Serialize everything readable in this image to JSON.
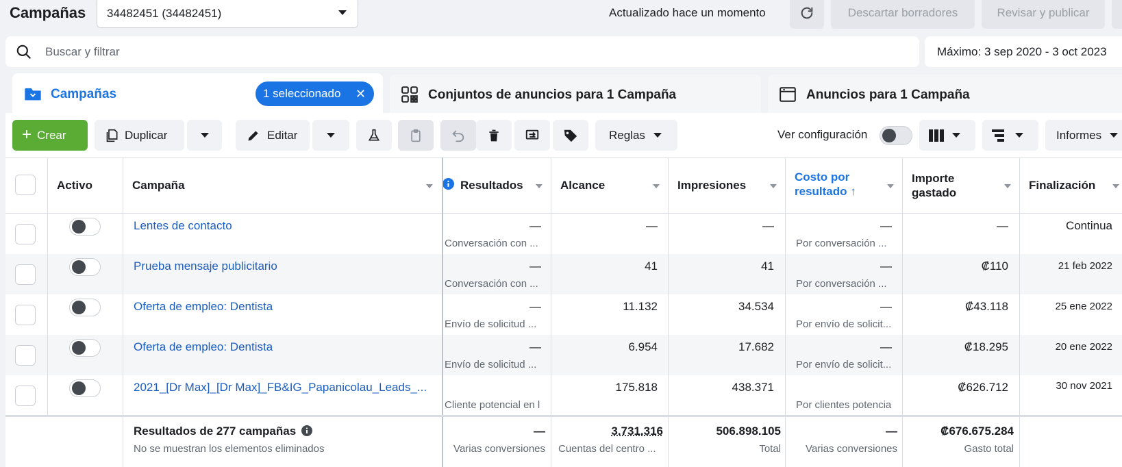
{
  "header": {
    "title": "Campañas",
    "account": "34482451 (34482451)",
    "updated": "Actualizado hace un momento",
    "discard": "Descartar borradores",
    "publish": "Revisar y publicar"
  },
  "search": {
    "placeholder": "Buscar y filtrar",
    "date_range": "Máximo: 3 sep 2020 - 3 oct 2023"
  },
  "tabs": [
    {
      "label": "Campañas",
      "selected_pill": "1 seleccionado",
      "icon": "folder-icon"
    },
    {
      "label": "Conjuntos de anuncios para 1 Campaña",
      "icon": "grid-icon"
    },
    {
      "label": "Anuncios para 1 Campaña",
      "icon": "ad-icon"
    }
  ],
  "toolbar": {
    "create": "Crear",
    "duplicate": "Duplicar",
    "edit": "Editar",
    "rules": "Reglas",
    "view_settings": "Ver configuración",
    "reports": "Informes"
  },
  "columns": {
    "active": "Activo",
    "campaign": "Campaña",
    "results": "Resultados",
    "reach": "Alcance",
    "impressions": "Impresiones",
    "cost_line1": "Costo por",
    "cost_line2": "resultado ↑",
    "spent_line1": "Importe",
    "spent_line2": "gastado",
    "end": "Finalización"
  },
  "rows": [
    {
      "name": "Lentes de contacto",
      "results": "—",
      "results_sub": "Conversación con ...",
      "reach": "—",
      "impressions": "—",
      "cost": "—",
      "cost_sub": "Por conversación ...",
      "spent": "—",
      "end": "Continua"
    },
    {
      "name": "Prueba mensaje publicitario",
      "results": "—",
      "results_sub": "Conversación con ...",
      "reach": "41",
      "impressions": "41",
      "cost": "—",
      "cost_sub": "Por conversación ...",
      "spent": "₡110",
      "end": "21 feb 2022"
    },
    {
      "name": "Oferta de empleo: Dentista",
      "results": "—",
      "results_sub": "Envío de solicitud ...",
      "reach": "11.132",
      "impressions": "34.534",
      "cost": "—",
      "cost_sub": "Por envío de solicit...",
      "spent": "₡43.118",
      "end": "25 ene 2022"
    },
    {
      "name": "Oferta de empleo: Dentista",
      "results": "—",
      "results_sub": "Envío de solicitud ...",
      "reach": "6.954",
      "impressions": "17.682",
      "cost": "—",
      "cost_sub": "Por envío de solicit...",
      "spent": "₡18.295",
      "end": "20 ene 2022"
    },
    {
      "name": "2021_[Dr Max]_[Dr Max]_FB&IG_Papanicolau_Leads_...",
      "results": "",
      "results_sub": "Cliente potencial en l",
      "reach": "175.818",
      "impressions": "438.371",
      "cost": "",
      "cost_sub": "Por clientes potencia",
      "spent": "₡626.712",
      "end": "30 nov 2021"
    }
  ],
  "totals": {
    "label": "Resultados de 277 campañas",
    "note": "No se muestran los elementos eliminados",
    "results": "—",
    "results_sub": "Varias conversiones",
    "reach": "3.731.316",
    "reach_sub": "Cuentas del centro ...",
    "impressions": "506.898.105",
    "impressions_sub": "Total",
    "cost": "—",
    "cost_sub": "Varias conversiones",
    "spent": "₡676.675.284",
    "spent_sub": "Gasto total"
  },
  "colors": {
    "accent": "#1b74e4",
    "link": "#1b5dbf",
    "create": "#5aac34"
  }
}
